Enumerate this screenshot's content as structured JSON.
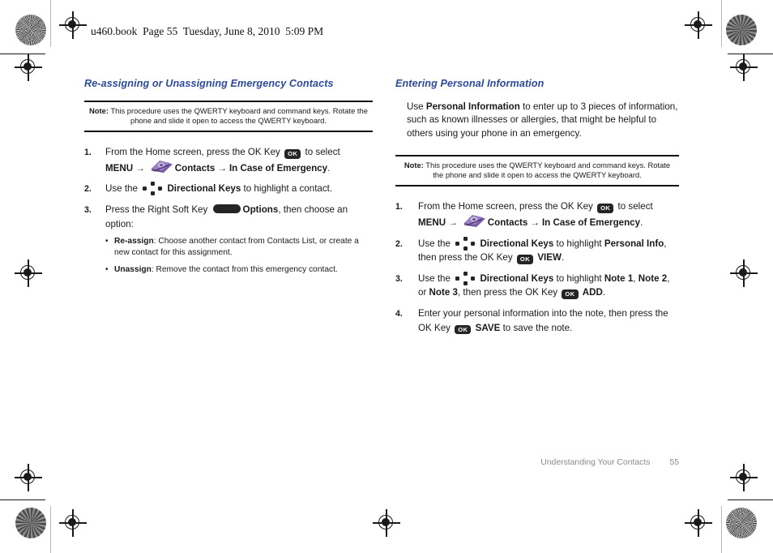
{
  "file_header": "u460.book  Page 55  Tuesday, June 8, 2010  5:09 PM",
  "colors": {
    "heading_blue": "#2b4a9b",
    "key_dark": "#252525",
    "icon_purple": "#7b5ea7",
    "icon_purple_light": "#b9a2d4",
    "footer_gray": "#8a8a8a"
  },
  "left_column": {
    "section_title": "Re-assigning or Unassigning Emergency Contacts",
    "note": {
      "label": "Note:",
      "text": "This procedure uses the QWERTY keyboard and command keys. Rotate the phone and slide it open to access the QWERTY keyboard."
    },
    "steps": [
      {
        "number": "1.",
        "line1_a": "From the Home screen, press the OK Key",
        "ok_key_label": "OK",
        "line1_b": "to select",
        "menu_label": "MENU",
        "arrow": "→",
        "contacts_label": "Contacts",
        "arrow2": "→",
        "ice_label": "In Case of Emergency",
        "period": "."
      },
      {
        "number": "2.",
        "text_a": "Use the",
        "dir_keys_label": "Directional Keys",
        "text_b": "to highlight a contact."
      },
      {
        "number": "3.",
        "text_a": "Press the Right Soft Key",
        "options_label": "Options",
        "text_b": ", then choose an option:",
        "bullets": [
          {
            "dot": "•",
            "term": "Re-assign",
            "text": ": Choose another contact from Contacts List, or create a new contact for this assignment."
          },
          {
            "dot": "•",
            "term": "Unassign",
            "text": ": Remove the contact from this emergency contact."
          }
        ]
      }
    ]
  },
  "right_column": {
    "section_title": "Entering Personal Information",
    "intro_a": "Use",
    "intro_bold": "Personal Information",
    "intro_b": "to enter up to 3 pieces of information, such as known illnesses or allergies, that might be helpful to others using your phone in an emergency.",
    "note": {
      "label": "Note:",
      "text": "This procedure uses the QWERTY keyboard and command keys. Rotate the phone and slide it open to access the QWERTY keyboard."
    },
    "steps": [
      {
        "number": "1.",
        "line1_a": "From the Home screen, press the OK Key",
        "ok_key_label": "OK",
        "line1_b": "to select",
        "menu_label": "MENU",
        "arrow": "→",
        "contacts_label": "Contacts",
        "arrow2": "→",
        "ice_label": "In Case of Emergency",
        "period": "."
      },
      {
        "number": "2.",
        "text_a": "Use the",
        "dir_keys_label": "Directional Keys",
        "text_b": "to highlight",
        "target_bold": "Personal Info",
        "text_c": ", then press the OK Key",
        "ok_key_label": "OK",
        "action_label": "VIEW",
        "period": "."
      },
      {
        "number": "3.",
        "text_a": "Use the",
        "dir_keys_label": "Directional Keys",
        "text_b": "to highlight",
        "note1": "Note 1",
        "sep1": ",",
        "note2": "Note 2",
        "sep2": ", or",
        "note3": "Note 3",
        "text_c": ", then press the OK Key",
        "ok_key_label": "OK",
        "action_label": "ADD",
        "period": "."
      },
      {
        "number": "4.",
        "text_a": "Enter your personal information into the note, then press the OK Key",
        "ok_key_label": "OK",
        "action_label": "SAVE",
        "text_b": "to save the note."
      }
    ]
  },
  "footer": {
    "title": "Understanding Your Contacts",
    "page_number": "55"
  }
}
